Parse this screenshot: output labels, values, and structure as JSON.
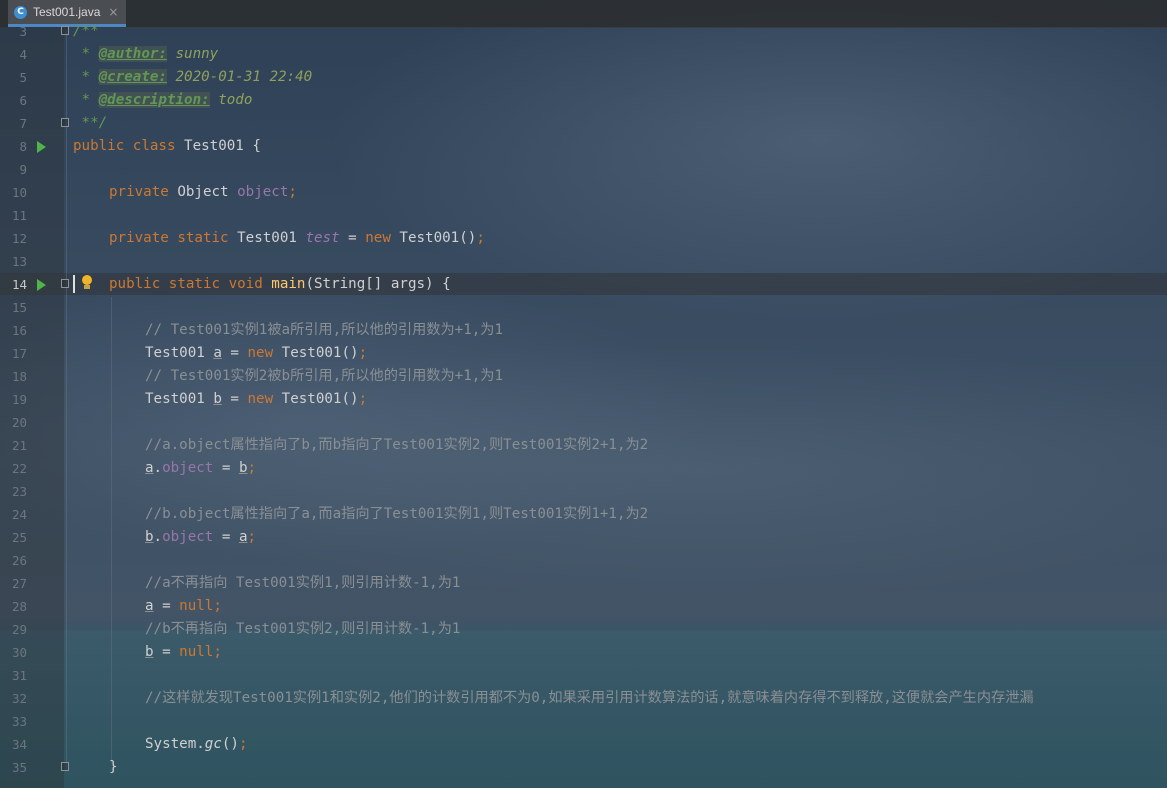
{
  "tab": {
    "icon": "java-class-icon",
    "label": "Test001.java",
    "close": "×"
  },
  "lines": [
    {
      "n": "3",
      "t": "/**"
    },
    {
      "n": "4",
      "a": " * ",
      "b": "@author:",
      "c": " sunny"
    },
    {
      "n": "5",
      "a": " * ",
      "b": "@create:",
      "c": " 2020-01-31 22:40"
    },
    {
      "n": "6",
      "a": " * ",
      "b": "@description:",
      "c": " todo"
    },
    {
      "n": "7",
      "t": " **/"
    },
    {
      "n": "8",
      "kw": "public class",
      "rest": " Test001 {"
    },
    {
      "n": "9"
    },
    {
      "n": "10",
      "kw": "private",
      "type": " Object ",
      "field": "object",
      "end": ";"
    },
    {
      "n": "11"
    },
    {
      "n": "12",
      "kw": "private static",
      "type": " Test001 ",
      "field": "test",
      "eq": " = ",
      "kw2": "new",
      "rest": " Test001()",
      "end": ";"
    },
    {
      "n": "13"
    },
    {
      "n": "14",
      "kw": "public static void",
      "sp": " ",
      "fn": "main",
      "rest": "(String[] args) {"
    },
    {
      "n": "15"
    },
    {
      "n": "16",
      "cmt": "// Test001实例1被a所引用,所以他的引用数为+1,为1"
    },
    {
      "n": "17",
      "type": "Test001 ",
      "var": "a",
      "eq": " = ",
      "kw2": "new",
      "rest": " Test001()",
      "end": ";"
    },
    {
      "n": "18",
      "cmt": "// Test001实例2被b所引用,所以他的引用数为+1,为1"
    },
    {
      "n": "19",
      "type": "Test001 ",
      "var": "b",
      "eq": " = ",
      "kw2": "new",
      "rest": " Test001()",
      "end": ";"
    },
    {
      "n": "20"
    },
    {
      "n": "21",
      "cmt": "//a.object属性指向了b,而b指向了Test001实例2,则Test001实例2+1,为2"
    },
    {
      "n": "22",
      "var": "a",
      "dot": ".",
      "field": "object",
      "eq": " = ",
      "var2": "b",
      "end": ";"
    },
    {
      "n": "23"
    },
    {
      "n": "24",
      "cmt": "//b.object属性指向了a,而a指向了Test001实例1,则Test001实例1+1,为2"
    },
    {
      "n": "25",
      "var": "b",
      "dot": ".",
      "field": "object",
      "eq": " = ",
      "var2": "a",
      "end": ";"
    },
    {
      "n": "26"
    },
    {
      "n": "27",
      "cmt": "//a不再指向 Test001实例1,则引用计数-1,为1"
    },
    {
      "n": "28",
      "var": "a",
      "eq": " = ",
      "kw2": "null",
      "end": ";"
    },
    {
      "n": "29",
      "cmt": "//b不再指向 Test001实例2,则引用计数-1,为1"
    },
    {
      "n": "30",
      "var": "b",
      "eq": " = ",
      "kw2": "null",
      "end": ";"
    },
    {
      "n": "31"
    },
    {
      "n": "32",
      "cmt": "//这样就发现Test001实例1和实例2,他们的计数引用都不为0,如果采用引用计数算法的话,就意味着内存得不到释放,这便就会产生内存泄漏"
    },
    {
      "n": "33"
    },
    {
      "n": "34",
      "type": "System.",
      "ital": "gc",
      "rest": "()",
      "end": ";"
    },
    {
      "n": "35",
      "rest": "}"
    }
  ]
}
